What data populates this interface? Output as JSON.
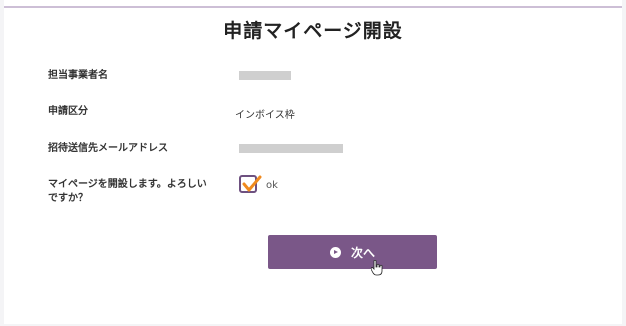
{
  "page": {
    "title": "申請マイページ開設"
  },
  "form": {
    "fields": [
      {
        "label": "担当事業者名",
        "value": ""
      },
      {
        "label": "申請区分",
        "value": "インボイス枠"
      },
      {
        "label": "招待送信先メールアドレス",
        "value": ""
      },
      {
        "label": "マイページを開設します。よろしいですか？",
        "value": "ok"
      }
    ],
    "confirm_checked": true
  },
  "actions": {
    "next_label": "次へ"
  },
  "colors": {
    "accent": "#7a5788",
    "checkbox_border": "#6e5180",
    "check_mark": "#f08a1e"
  }
}
